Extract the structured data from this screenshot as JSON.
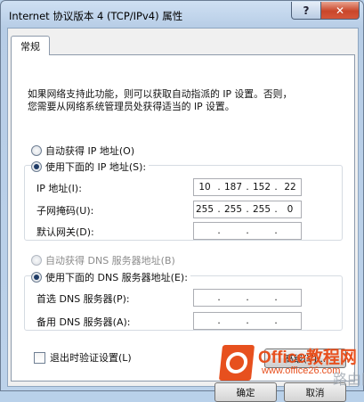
{
  "window": {
    "title": "Internet 协议版本 4 (TCP/IPv4) 属性",
    "help_label": "?",
    "close_label": "✕"
  },
  "tabs": [
    {
      "label": "常规",
      "selected": true
    }
  ],
  "description": {
    "line1": "如果网络支持此功能，则可以获取自动指派的 IP 设置。否则，",
    "line2": "您需要从网络系统管理员处获得适当的 IP 设置。"
  },
  "ip_section": {
    "auto_label": "自动获得 IP 地址(O)",
    "manual_label": "使用下面的 IP 地址(S):",
    "selected": "manual",
    "fields": [
      {
        "label": "IP 地址(I):",
        "value": [
          "10",
          "187",
          "152",
          "22"
        ]
      },
      {
        "label": "子网掩码(U):",
        "value": [
          "255",
          "255",
          "255",
          "0"
        ]
      },
      {
        "label": "默认网关(D):",
        "value": [
          "",
          "",
          "",
          ""
        ]
      }
    ]
  },
  "dns_section": {
    "auto_label": "自动获得 DNS 服务器地址(B)",
    "auto_disabled": true,
    "manual_label": "使用下面的 DNS 服务器地址(E):",
    "selected": "manual",
    "fields": [
      {
        "label": "首选 DNS 服务器(P):",
        "value": [
          "",
          "",
          "",
          ""
        ]
      },
      {
        "label": "备用 DNS 服务器(A):",
        "value": [
          "",
          "",
          "",
          ""
        ]
      }
    ]
  },
  "validate_checkbox": {
    "label": "退出时验证设置(L)",
    "checked": false
  },
  "buttons": {
    "advanced": "高级(V)...",
    "ok": "确定",
    "cancel": "取消"
  },
  "watermark": {
    "brand": "Office教程网",
    "url": "www.office26.com",
    "alt": "路由网"
  },
  "colors": {
    "frame": "#b9d1ea",
    "close": "#c9462a",
    "watermark": "#e7501e"
  }
}
